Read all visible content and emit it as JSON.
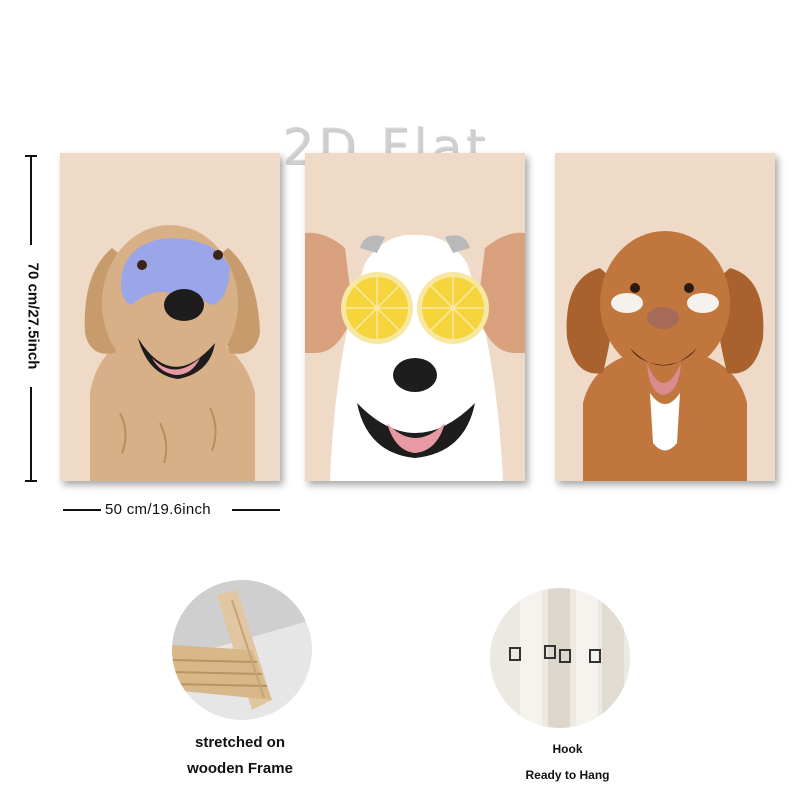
{
  "watermark": "2D Flat",
  "dimensions": {
    "height_label": "70 cm/27.5inch",
    "width_label": "50 cm/19.6inch"
  },
  "panels": [
    {
      "subject": "golden-retriever-with-blue-face-mask",
      "background": "#efd9c7"
    },
    {
      "subject": "white-dog-with-lemon-slices",
      "background": "#efd9c7"
    },
    {
      "subject": "brown-dog-with-under-eye-patches",
      "background": "#efd9c7"
    }
  ],
  "features": [
    {
      "caption_lines": [
        "stretched on",
        "wooden Frame"
      ],
      "icon": "wooden-frame-closeup"
    },
    {
      "caption_lines": [
        "Hook",
        "Ready to Hang"
      ],
      "icon": "hanging-hook-closeup"
    }
  ],
  "colors": {
    "panel_bg": "#efd9c7",
    "golden_fur": "#d8b087",
    "mask_blue": "#9aa6e8",
    "lemon": "#f6d43c",
    "brown_fur": "#c0763c"
  }
}
